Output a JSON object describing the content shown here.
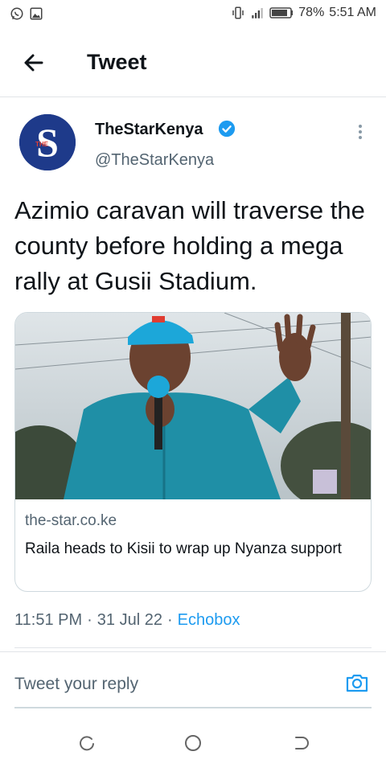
{
  "status_bar": {
    "battery": "78%",
    "time": "5:51 AM",
    "left_icons": [
      "whatsapp-icon",
      "image-icon"
    ],
    "right_icons": [
      "vibrate-icon",
      "signal-icon",
      "battery-icon"
    ]
  },
  "header": {
    "title": "Tweet",
    "back_icon": "back-arrow-icon"
  },
  "author": {
    "name": "TheStarKenya",
    "handle": "@TheStarKenya",
    "verified": true,
    "avatar_label": "THE",
    "avatar_letter": "S"
  },
  "tweet": {
    "text": "Azimio caravan will traverse the county before holding a mega rally at Gusii Stadium."
  },
  "card": {
    "domain": "the-star.co.ke",
    "title": "Raila heads to Kisii to wrap up Nyanza support"
  },
  "meta": {
    "time": "11:51 PM",
    "sep1": "·",
    "date": "31 Jul 22",
    "sep2": "·",
    "source": "Echobox"
  },
  "reply": {
    "placeholder": "Tweet your reply"
  },
  "colors": {
    "accent": "#1d9bf0",
    "text_primary": "#0f1419",
    "text_secondary": "#536471",
    "avatar_bg": "#1e3a8a"
  }
}
